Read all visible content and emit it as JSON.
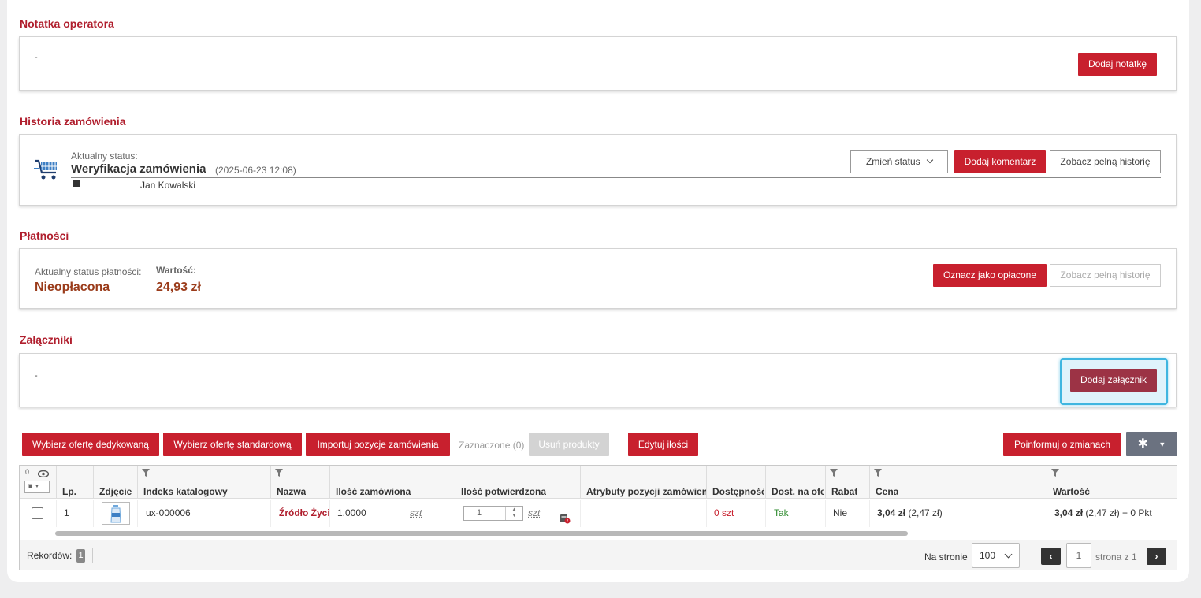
{
  "operator_note": {
    "title": "Notatka operatora",
    "content": "-",
    "add_button": "Dodaj notatkę"
  },
  "history": {
    "title": "Historia zamówienia",
    "status_label": "Aktualny status:",
    "status_value": "Weryfikacja zamówienia",
    "status_date": "(2025-06-23 12:08)",
    "author": "Jan Kowalski",
    "change_status_button": "Zmień status",
    "add_comment_button": "Dodaj komentarz",
    "full_history_button": "Zobacz pełną historię"
  },
  "payments": {
    "title": "Płatności",
    "status_label": "Aktualny status płatności:",
    "status_value": "Nieopłacona",
    "amount_label": "Wartość:",
    "amount_value": "24,93 zł",
    "mark_paid_button": "Oznacz jako opłacone",
    "full_history_button": "Zobacz pełną historię"
  },
  "attachments": {
    "title": "Załączniki",
    "content": "-",
    "add_button": "Dodaj załącznik"
  },
  "toolbar": {
    "dedicated_offer": "Wybierz ofertę dedykowaną",
    "standard_offer": "Wybierz ofertę standardową",
    "import_positions": "Importuj pozycje zamówienia",
    "selected": "Zaznaczone (0)",
    "remove_products": "Usuń produkty",
    "edit_quantities": "Edytuj ilości",
    "notify_changes": "Poinformuj o zmianach"
  },
  "grid": {
    "visible_count": "0",
    "columns": [
      "Lp.",
      "Zdjęcie",
      "Indeks katalogowy",
      "Nazwa",
      "Ilość zamówiona",
      "Ilość potwierdzona",
      "Atrybuty pozycji zamówienia",
      "Dostępność",
      "Dost. na ofercie",
      "Rabat",
      "Cena",
      "Wartość"
    ],
    "rows": [
      {
        "lp": "1",
        "index": "ux-000006",
        "name": "Źródło Życia",
        "ordered_qty": "1.0000",
        "ordered_unit": "szt",
        "confirmed_qty": "1",
        "confirmed_unit": "szt",
        "availability": "0 szt",
        "on_offer": "Tak",
        "discount": "Nie",
        "price_bold": "3,04 zł",
        "price_net": "(2,47 zł)",
        "value_bold": "3,04 zł",
        "value_rest": "(2,47 zł) + 0 Pkt"
      }
    ]
  },
  "footer": {
    "records_label": "Rekordów:",
    "records_count": "1",
    "per_page_label": "Na stronie",
    "per_page_value": "100",
    "page_input": "1",
    "page_of": "strona z 1"
  },
  "colors": {
    "brand_red": "#c8202e",
    "section_title": "#b01e2d",
    "status_value": "#9a3b1a",
    "highlight_border": "#3fb6e0"
  }
}
